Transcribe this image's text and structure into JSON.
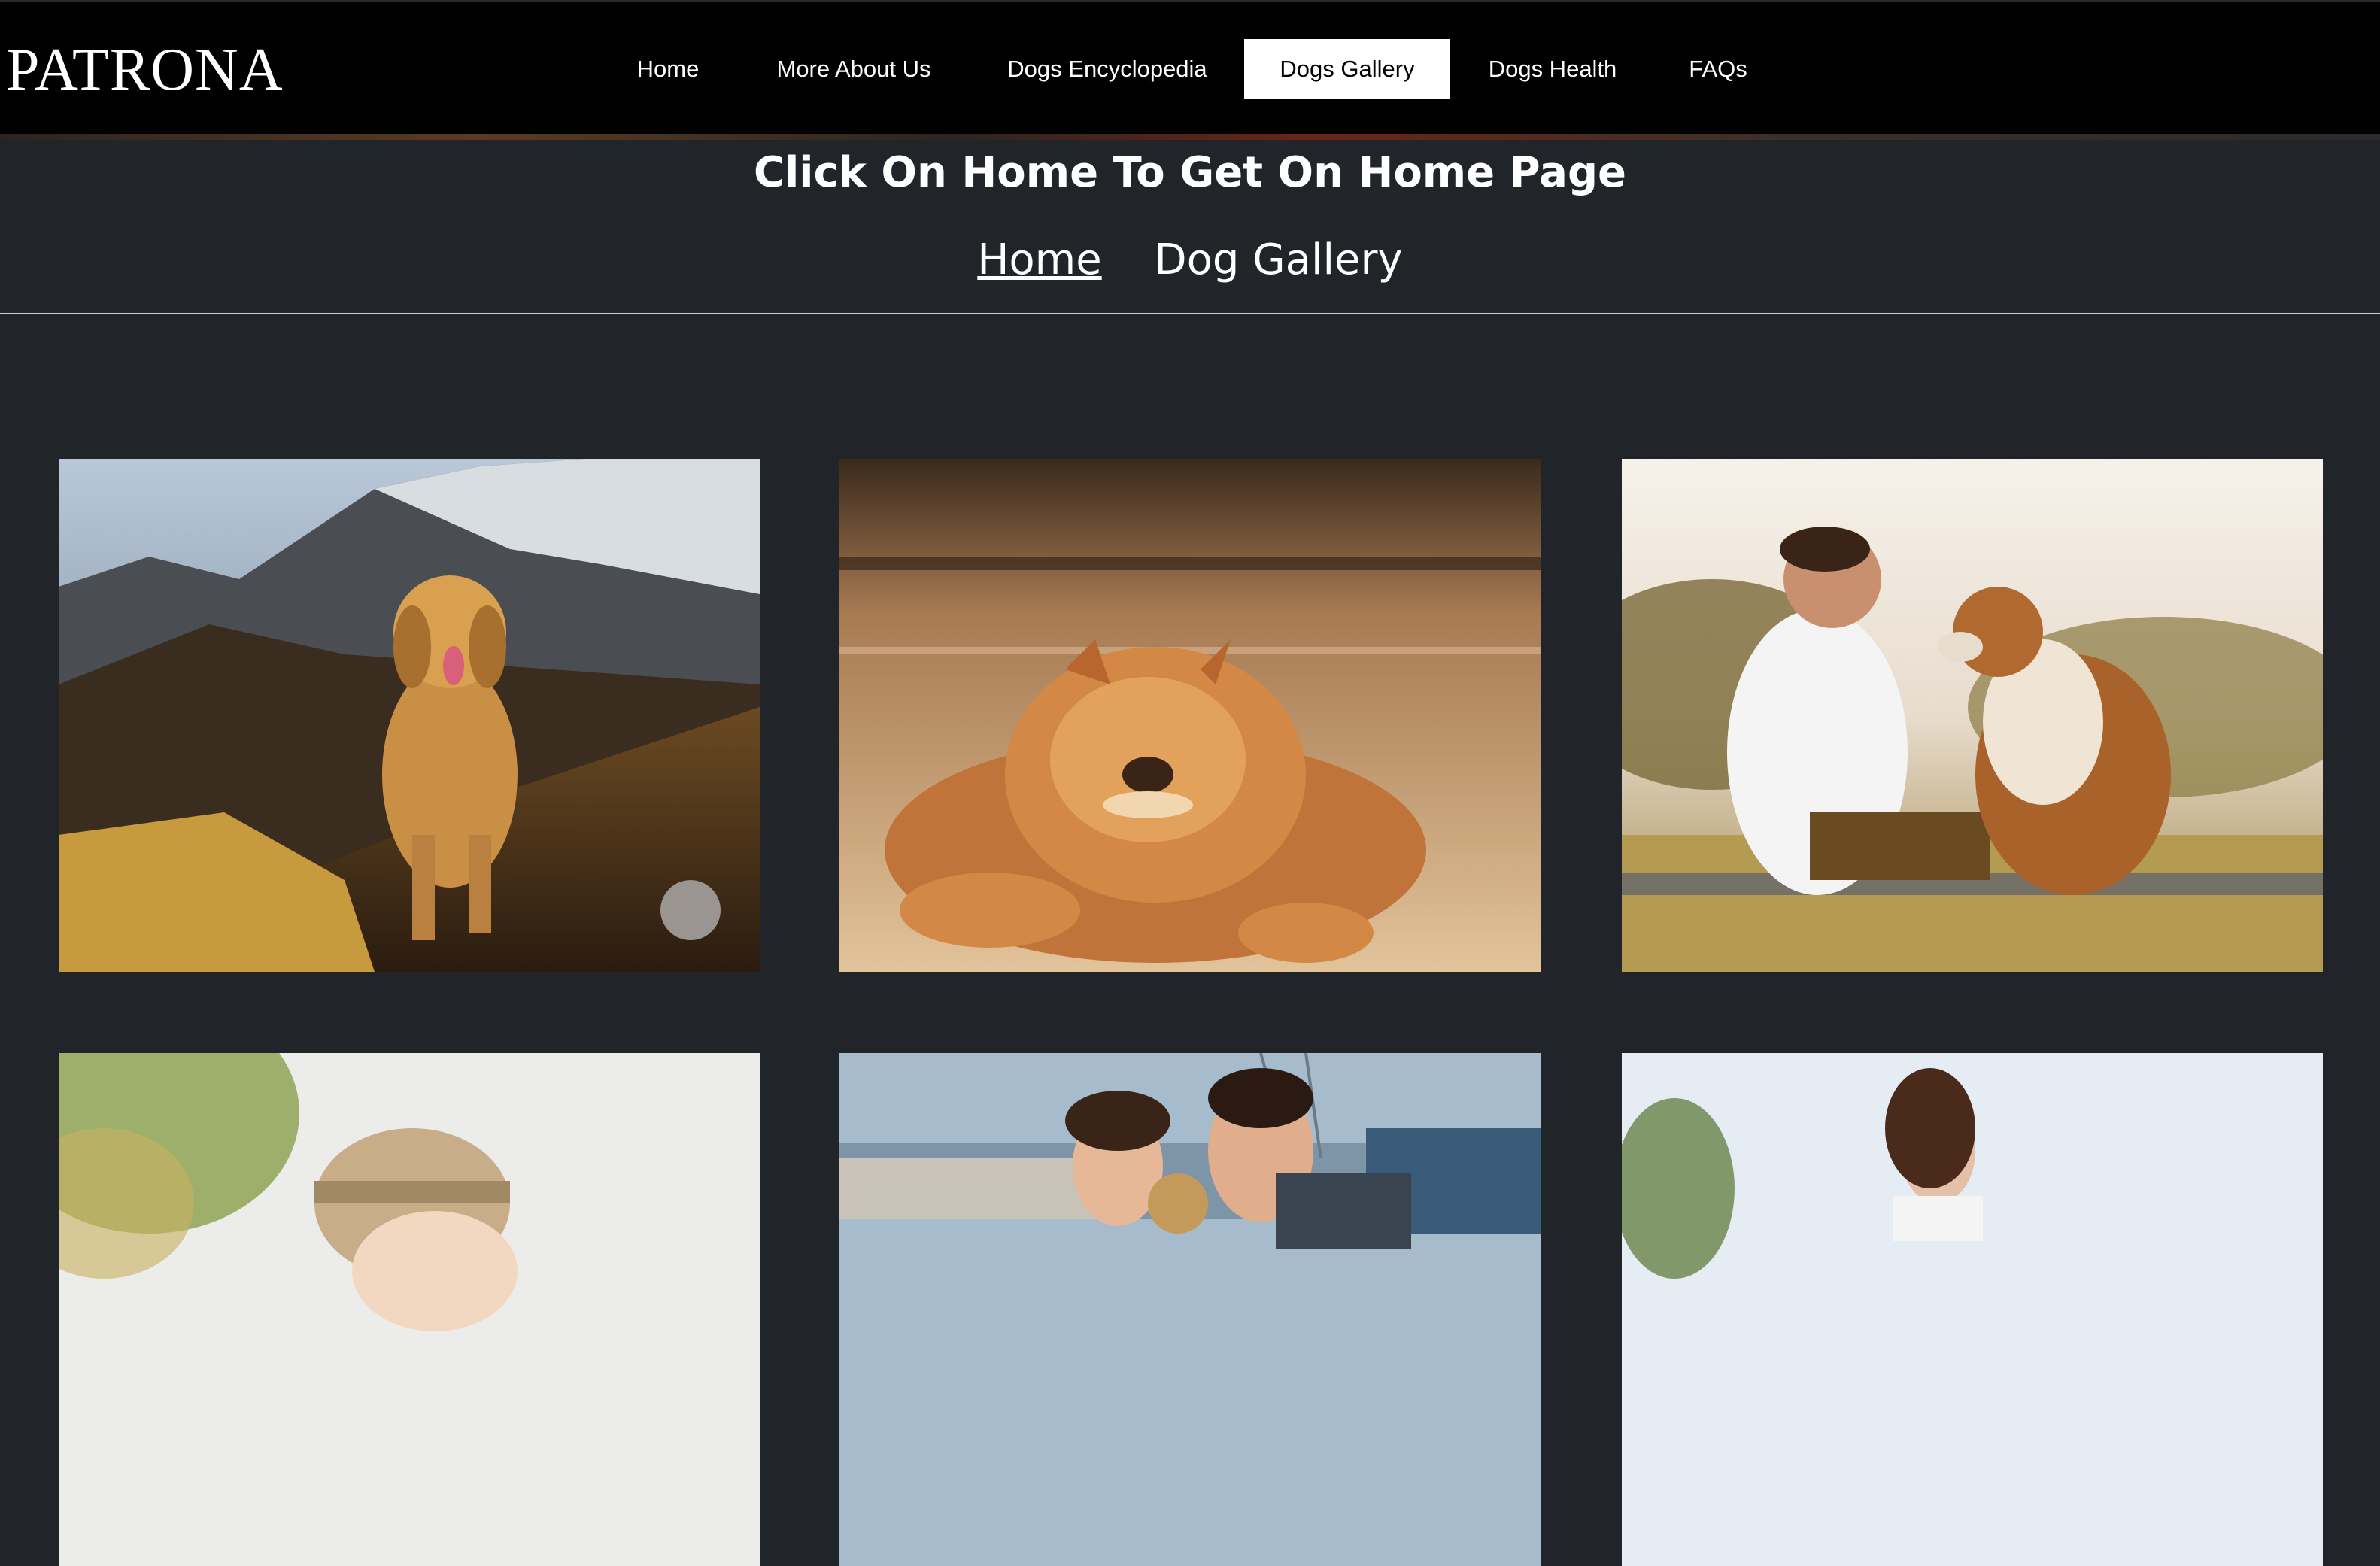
{
  "brand": "PATRONA",
  "nav": {
    "items": [
      {
        "label": "Home"
      },
      {
        "label": "More About Us"
      },
      {
        "label": "Dogs Encyclopedia"
      },
      {
        "label": "Dogs Gallery",
        "active": true
      },
      {
        "label": "Dogs Health"
      },
      {
        "label": "FAQs"
      }
    ]
  },
  "page": {
    "heading": "Click On Home To Get On Home Page",
    "breadcrumb": {
      "home": "Home",
      "current": "Dog Gallery"
    }
  },
  "colors": {
    "navbar_bg": "#000000",
    "page_bg": "#212529",
    "active_tab_bg": "#ffffff",
    "text": "#ffffff"
  }
}
